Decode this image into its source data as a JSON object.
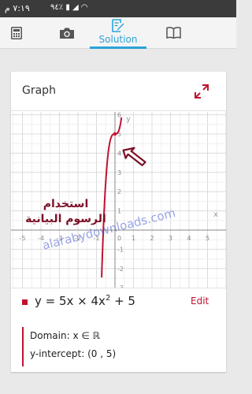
{
  "status_bar": {
    "time": "٧:١٩ م",
    "battery": "٩٤٪"
  },
  "tabs": {
    "solution_label": "Solution"
  },
  "graph_card": {
    "title": "Graph"
  },
  "graph": {
    "x_axis_label": "x",
    "y_axis_label": "y",
    "x_ticks": [
      "-5",
      "-4",
      "-3",
      "-2",
      "-1",
      "0",
      "1",
      "2",
      "3",
      "4",
      "5"
    ],
    "y_ticks": [
      "6",
      "5",
      "4",
      "3",
      "2",
      "1",
      "-1",
      "-2",
      "-3"
    ],
    "curve_color": "#c0122f",
    "annotation_arrow_color": "#7c1127"
  },
  "annotation": {
    "line1": "استخدام",
    "line2": "الرسوم البيانية"
  },
  "watermark": "alarabydownloads.com",
  "equation": {
    "prefix": "y = 5x × 4x",
    "exponent": "2",
    "suffix": " + 5",
    "edit_label": "Edit"
  },
  "details": {
    "domain_label": "Domain:",
    "domain_value": "x ∈ ℝ",
    "yint_label": "y-intercept:",
    "yint_value": "(0 , 5)"
  },
  "chart_data": {
    "type": "line",
    "function": "y = 5x × 4x^2 + 5",
    "x": [
      -0.8,
      -0.7,
      -0.6,
      -0.5,
      -0.4,
      -0.3,
      -0.2,
      -0.1,
      0,
      0.1,
      0.2,
      0.3,
      0.4,
      0.5
    ],
    "y": [
      -5.24,
      -1.86,
      0.68,
      2.5,
      3.72,
      4.46,
      4.84,
      4.98,
      5,
      5.02,
      5.16,
      5.54,
      6.28,
      7.5
    ],
    "xlim": [
      -5.5,
      5.5
    ],
    "ylim": [
      -3.3,
      6.2
    ],
    "grid": true
  }
}
